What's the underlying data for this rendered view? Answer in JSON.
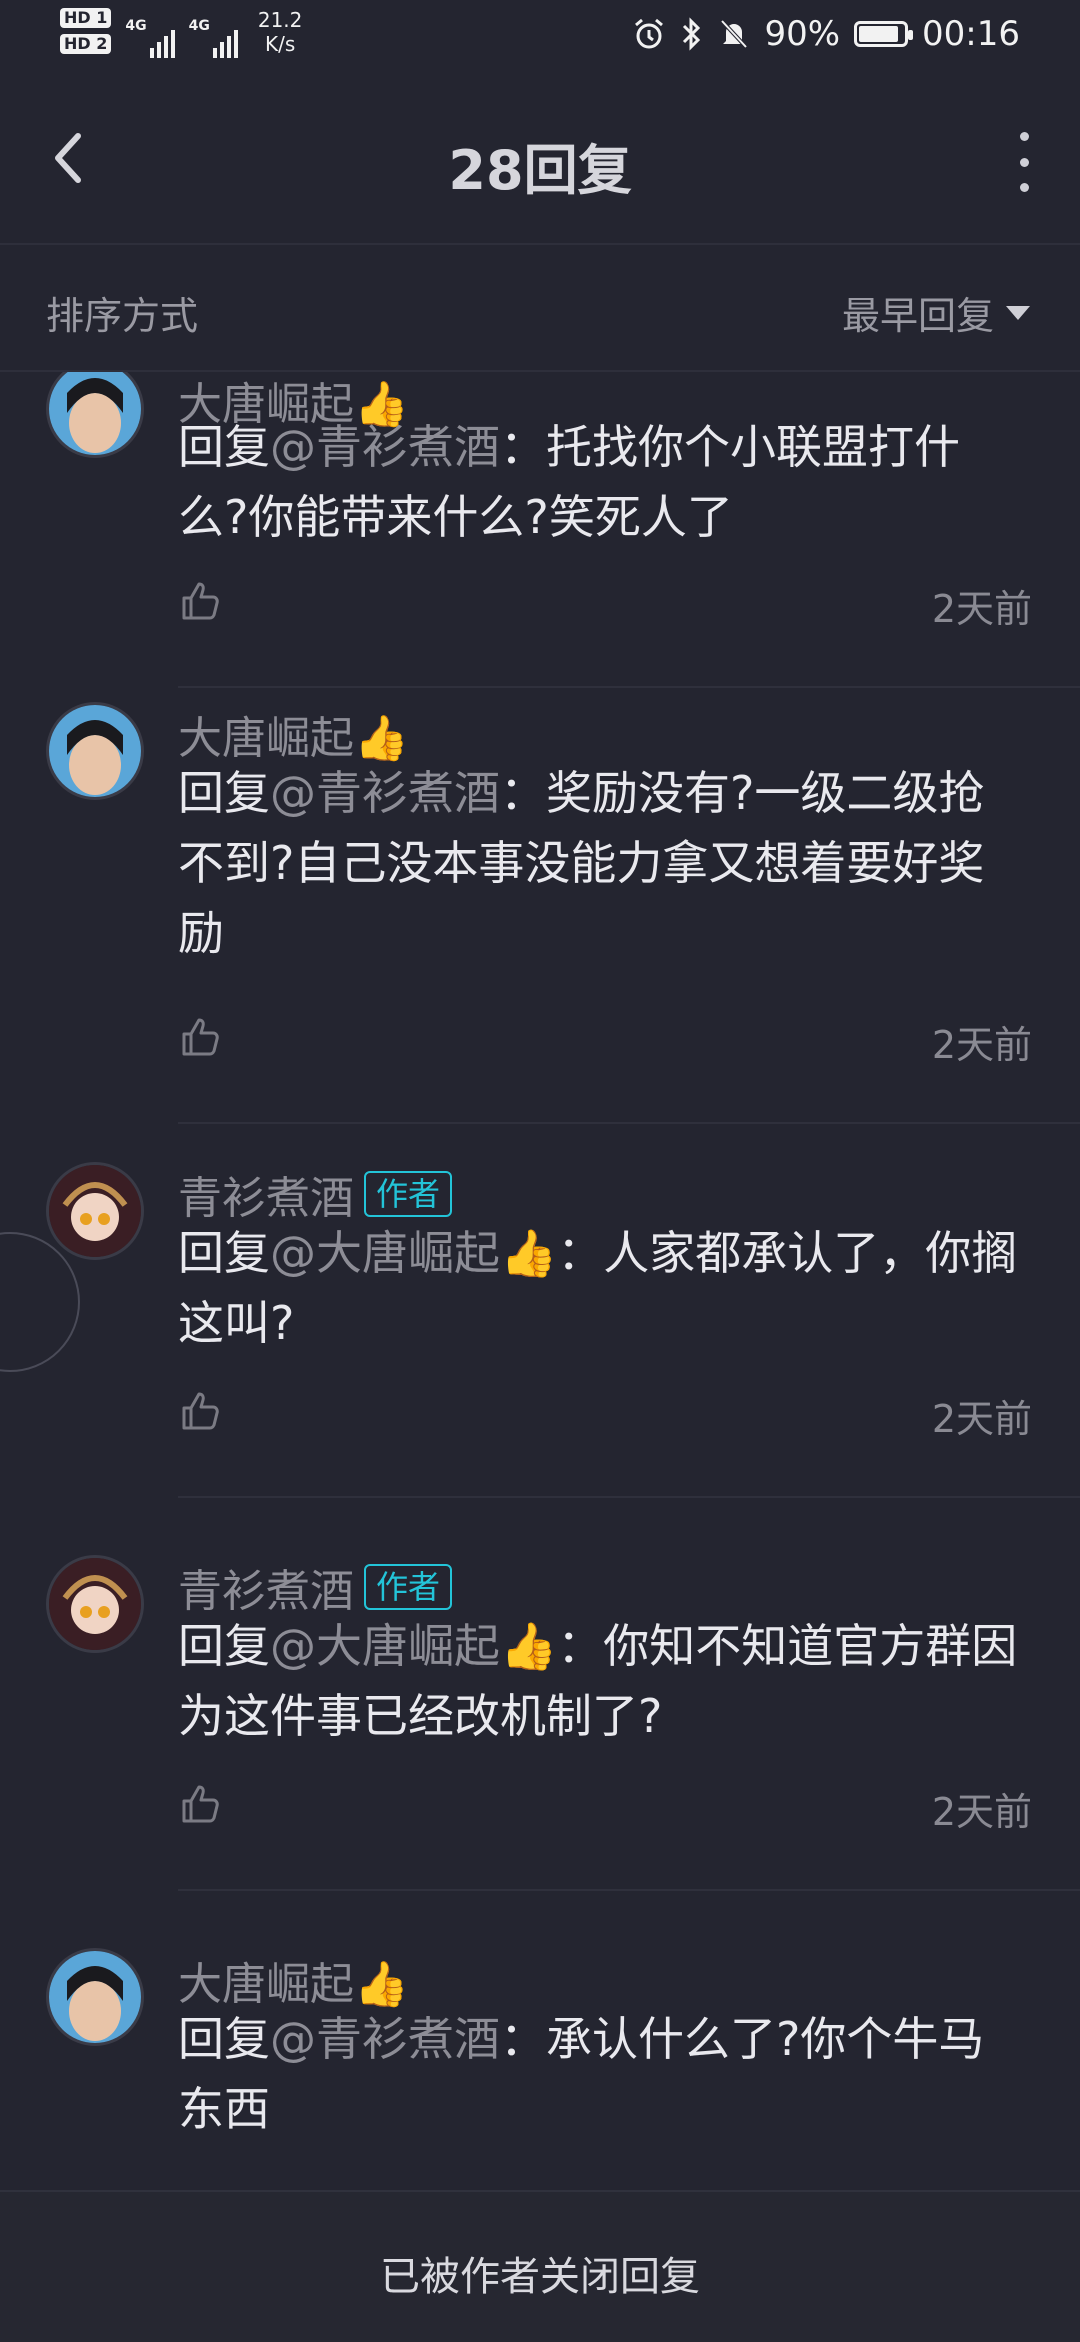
{
  "status_bar": {
    "hd1": "HD 1",
    "hd2": "HD 2",
    "sim1": "4G",
    "sim2": "4G",
    "speed_value": "21.2",
    "speed_unit": "K/s",
    "battery": "90%",
    "battery_fill": 0.9,
    "time": "00:16"
  },
  "header": {
    "title": "28回复"
  },
  "sort": {
    "label": "排序方式",
    "value": "最早回复"
  },
  "comments": [
    {
      "name": "大唐崛起👍",
      "badge": "",
      "reply_prefix": "回复",
      "mention": "@青衫煮酒",
      "body": "：托找你个小联盟打什么?你能带来什么?笑死人了",
      "time": "2天前"
    },
    {
      "name": "大唐崛起👍",
      "badge": "",
      "reply_prefix": "回复",
      "mention": "@青衫煮酒",
      "body": "：奖励没有?一级二级抢不到?自己没本事没能力拿又想着要好奖励",
      "time": "2天前"
    },
    {
      "name": "青衫煮酒",
      "badge": "作者",
      "reply_prefix": "回复",
      "mention": "@大唐崛起👍",
      "body": "：人家都承认了，你搁这叫?",
      "time": "2天前"
    },
    {
      "name": "青衫煮酒",
      "badge": "作者",
      "reply_prefix": "回复",
      "mention": "@大唐崛起👍",
      "body": "：你知不知道官方群因为这件事已经改机制了?",
      "time": "2天前"
    },
    {
      "name": "大唐崛起👍",
      "badge": "",
      "reply_prefix": "回复",
      "mention": "@青衫煮酒",
      "body": "：承认什么了?你个牛马东西",
      "time": ""
    }
  ],
  "footer": {
    "text": "已被作者关闭回复"
  },
  "icons": {
    "back": "chevron-left-icon",
    "more": "more-vertical-icon",
    "sort": "triangle-down-icon",
    "like": "thumbs-up-icon"
  },
  "colors": {
    "background": "#242530",
    "author_badge": "#23c4d8",
    "secondary_text": "#8d8d96"
  }
}
